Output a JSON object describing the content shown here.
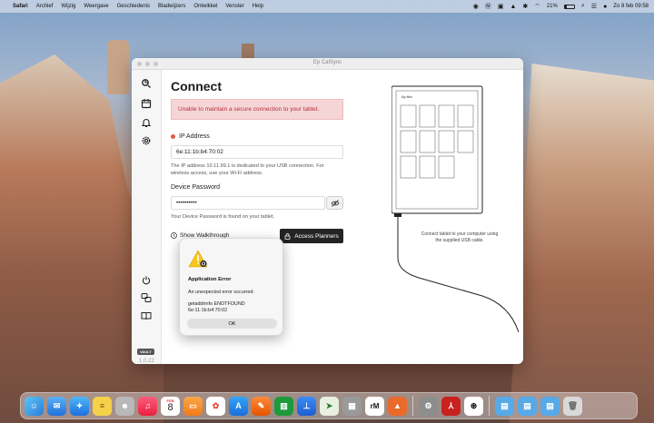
{
  "menubar": {
    "app_name": "Safari",
    "items": [
      "Archief",
      "Wijzig",
      "Weergave",
      "Geschiedenis",
      "Bladwijzers",
      "Ontwikkel",
      "Venster",
      "Help"
    ],
    "battery": "21%",
    "datetime": "Zo 8 feb  09:58"
  },
  "window": {
    "title": "Ep CalSync"
  },
  "sidebar": {
    "vault_badge": "VAULT",
    "version": "1.0.22"
  },
  "main": {
    "heading": "Connect",
    "alert": "Unable to maintain a secure connection to your tablet.",
    "ip_label": "IP Address",
    "ip_value": "6e:11:1b:b4:70:02",
    "ip_help": "The IP address 10.11.99.1 is dedicated to your USB connection. For wireless access, use your Wi-Fi address.",
    "password_label": "Device Password",
    "password_value": "••••••••••",
    "password_help": "Your Device Password is found on your tablet.",
    "walkthrough": "Show Walkthrough",
    "access_button": "Access Planners"
  },
  "illustration": {
    "tablet_title": "My files",
    "caption": "Connect tablet to your computer using the supplied USB cable."
  },
  "dialog": {
    "title": "Application Error",
    "message": "An unexpected error occurred:",
    "detail_line1": "getaddrinfo ENOTFOUND",
    "detail_line2": "6e:11:1b:b4:70:02",
    "ok_label": "OK"
  },
  "dock": {
    "calendar_month": "FEB",
    "calendar_day": "8"
  },
  "colors": {
    "alert_bg": "#f6d5d6",
    "alert_text": "#b4303a",
    "status_dot": "#e4594d",
    "primary_button": "#242424"
  }
}
